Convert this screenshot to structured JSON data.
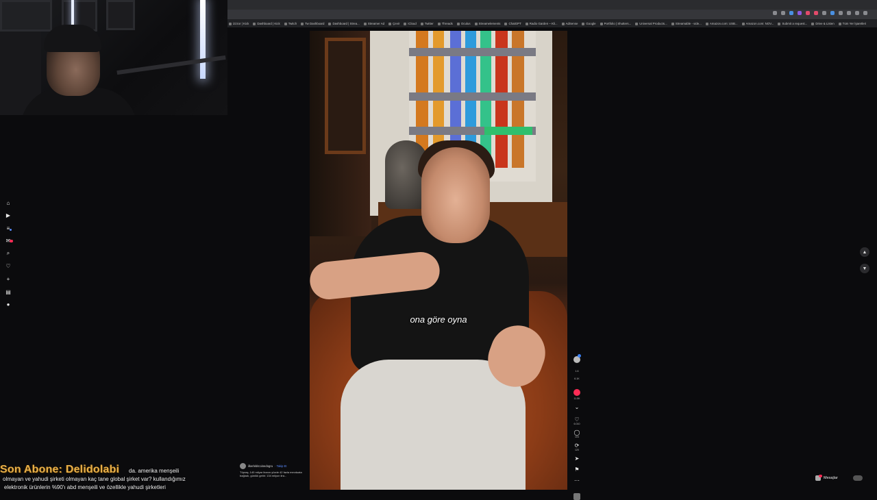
{
  "bookmarks": [
    "izzzor | Kick",
    "Dashboard | Kick",
    "Twitch",
    "Tw Dashboard",
    "Dashboard | Strea...",
    "Streamer Ad",
    "Çevir",
    "iCloud",
    "Twitter",
    "Threads",
    "Oculus",
    "Streamelements",
    "ChatGPT",
    "Radio Garden – Kli...",
    "AdSense",
    "Google",
    "Portfolio | Shutters...",
    "Universal Products...",
    "Streamable - vide...",
    "Amazon.com: USB...",
    "Amazon.com: NOV...",
    "Submit a request...",
    "Drive & Listen",
    "Tüm Yer İşaretleri"
  ],
  "sidebar": [
    {
      "name": "home-icon",
      "glyph": "⌂"
    },
    {
      "name": "video-icon",
      "glyph": "▶"
    },
    {
      "name": "list-icon",
      "glyph": "≡"
    },
    {
      "name": "inbox-icon",
      "glyph": "✉"
    },
    {
      "name": "search-icon",
      "glyph": "⌕"
    },
    {
      "name": "heart-icon",
      "glyph": "♡"
    },
    {
      "name": "plus-icon",
      "glyph": "+"
    },
    {
      "name": "message-icon",
      "glyph": "▤"
    },
    {
      "name": "profile-icon",
      "glyph": "●"
    }
  ],
  "video": {
    "subtitle": "ona göre oyna"
  },
  "rail": {
    "like_count": "6.010",
    "comment_count": "104",
    "share_count": "120",
    "stat_a": "1.6",
    "stat_b": "6.1K",
    "stat_c": "11.5K"
  },
  "caption": {
    "username": "ilkerlebitcoinedogru",
    "follow_label": "· Takip Et",
    "description": "Tüpraş, 140 milyar liranın yüzde 42 fazla mevduata bağladı, günlük getiri: 134 milyon lira..."
  },
  "messages": {
    "label": "Mesajlar"
  },
  "overlay": {
    "sub_label": "Son Abone: Delidolabi",
    "line1": "da. amerika menşeili",
    "line2": "olmayan ve yahudi şirketi olmayan kaç tane global şirket var? kullandığımız",
    "line3": "elektronik ürünlerin %90'ı abd menşeili ve özellikle yahudi şirketleri"
  },
  "colors": {
    "accent": "#fe2c55",
    "link": "#5b8cff",
    "overlay_gold": "#e8b04a"
  }
}
